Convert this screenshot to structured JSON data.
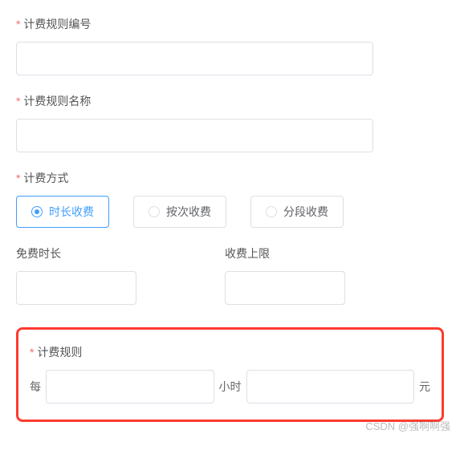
{
  "fields": {
    "ruleNo": {
      "label": "计费规则编号",
      "value": ""
    },
    "ruleName": {
      "label": "计费规则名称",
      "value": ""
    },
    "billingMethod": {
      "label": "计费方式",
      "options": [
        {
          "label": "时长收费",
          "selected": true
        },
        {
          "label": "按次收费",
          "selected": false
        },
        {
          "label": "分段收费",
          "selected": false
        }
      ]
    },
    "freeDuration": {
      "label": "免费时长",
      "value": ""
    },
    "chargeCap": {
      "label": "收费上限",
      "value": ""
    },
    "billingRule": {
      "label": "计费规则",
      "prefix": "每",
      "unit1": "小时",
      "unit2": "元",
      "hoursValue": "",
      "amountValue": ""
    }
  },
  "watermark": "CSDN @强啊啊强"
}
